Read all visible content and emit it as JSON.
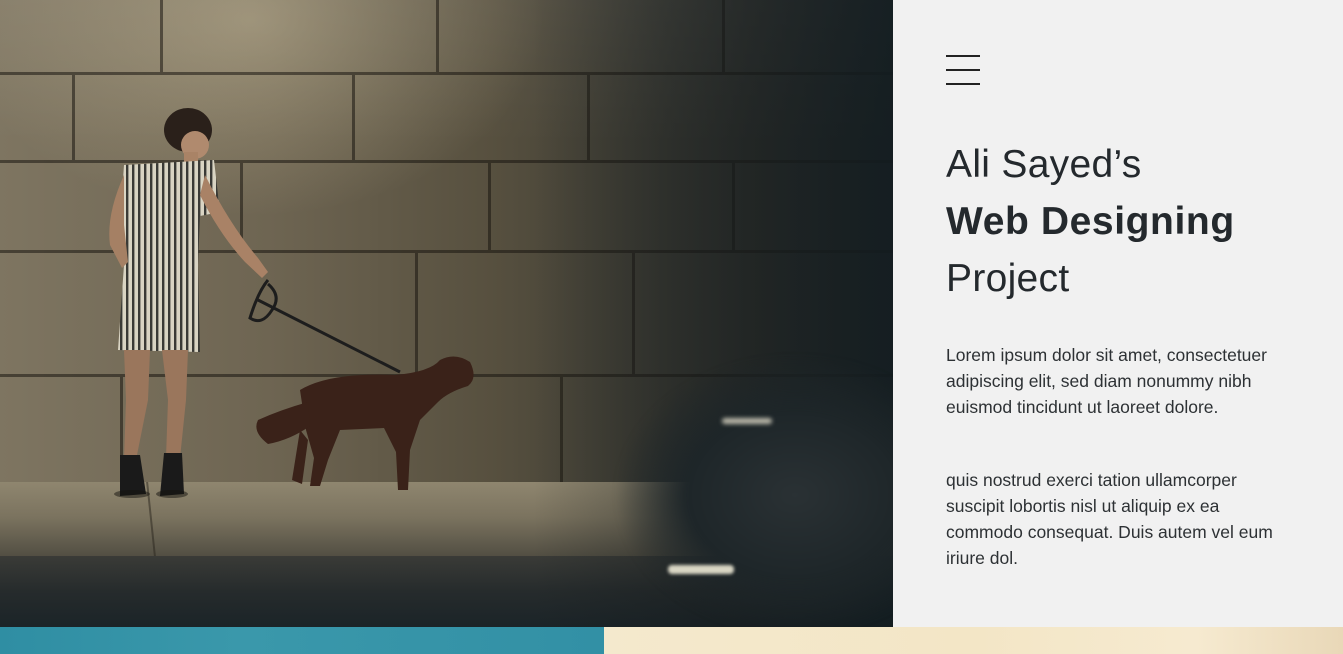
{
  "hero": {
    "image": "woman-walking-dog-photo"
  },
  "panel": {
    "menu_icon": "hamburger-menu-icon",
    "title_line1": "Ali Sayed’s",
    "title_line2": "Web Designing",
    "title_line3": "Project",
    "paragraph1": "Lorem ipsum dolor sit amet, consectetuer adipiscing elit, sed diam nonummy nibh euismod tincidunt ut laoreet dolore.",
    "paragraph2": "quis nostrud exerci tation ullamcorper suscipit lobortis nisl ut aliquip ex ea commodo consequat. Duis autem vel eum iriure dol."
  },
  "colors": {
    "panel_bg": "#f1f1f1",
    "text": "#24292d",
    "strip_left": "#3290a5",
    "strip_right": "#f4e9cd"
  }
}
